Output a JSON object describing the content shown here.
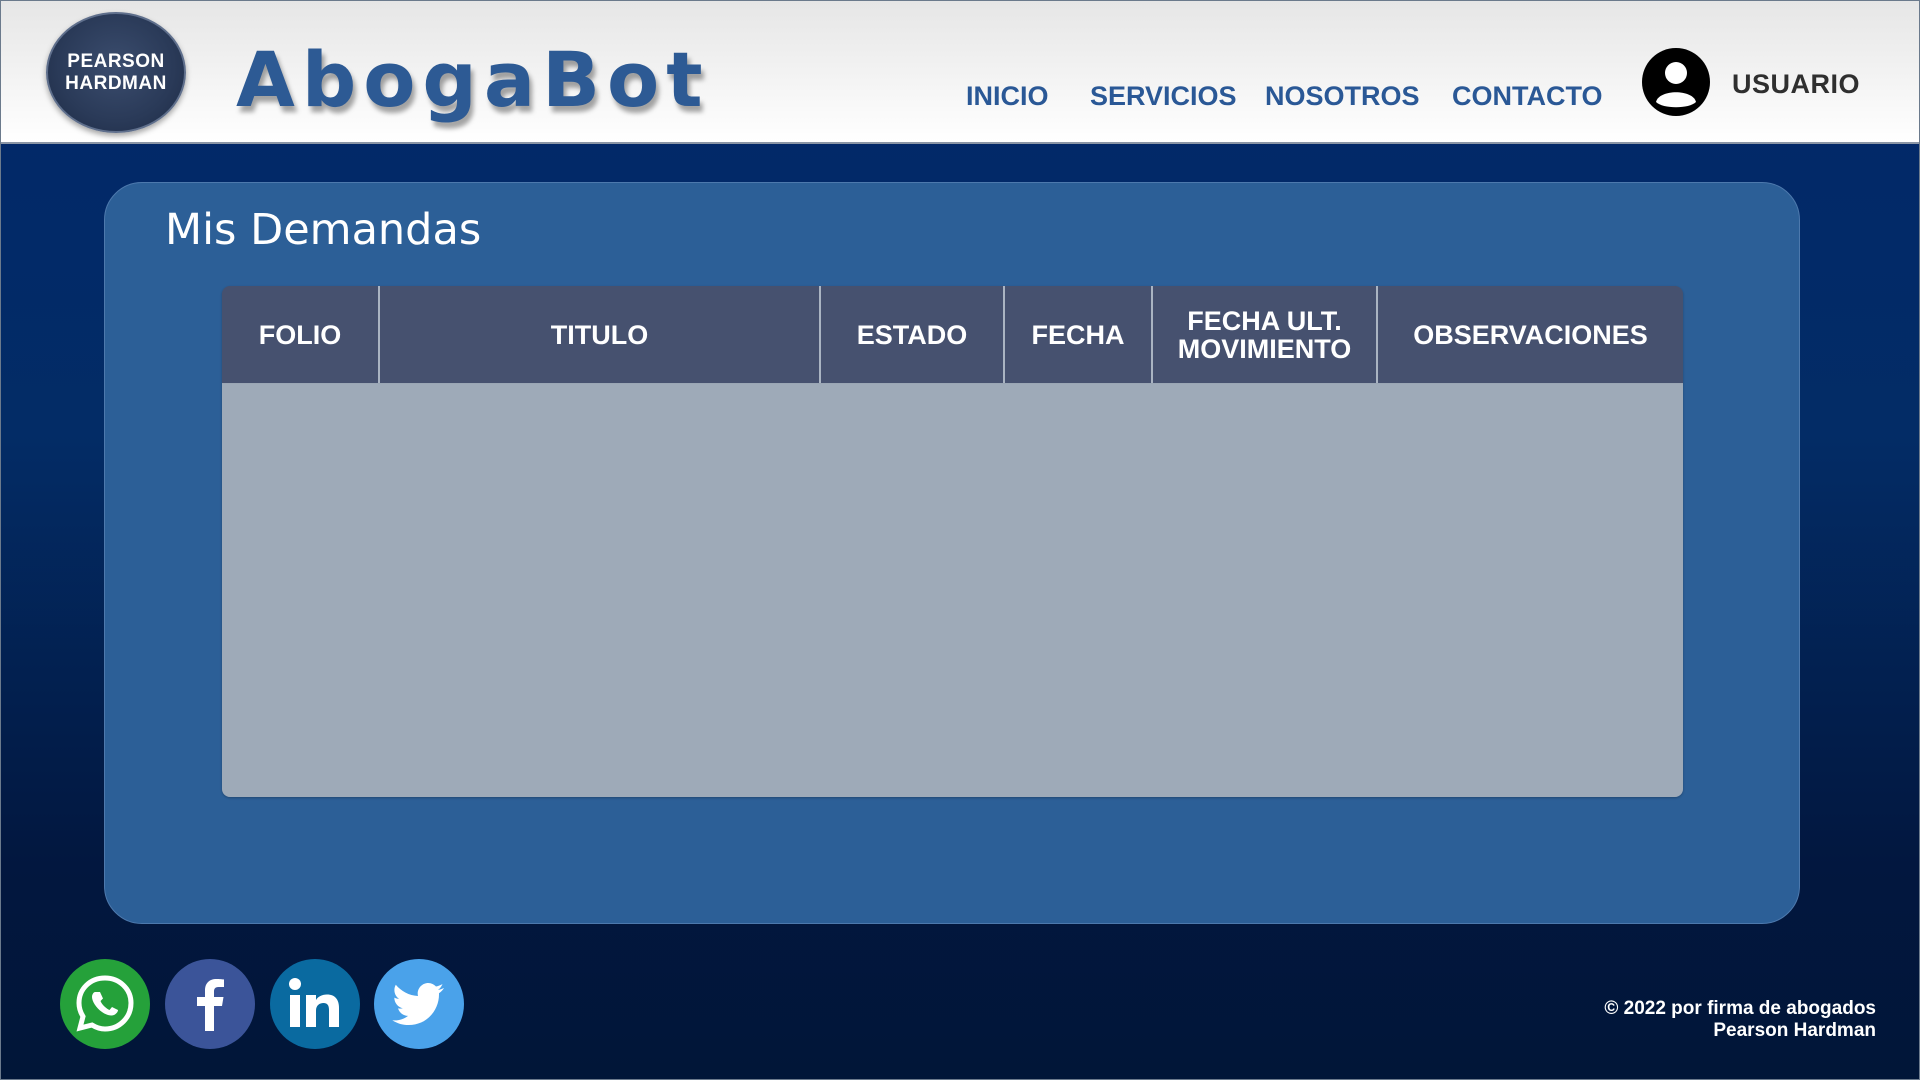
{
  "brand": {
    "badge_line1": "PEARSON",
    "badge_line2": "HARDMAN",
    "name": "AbogaBot"
  },
  "nav": {
    "items": [
      {
        "label": "INICIO"
      },
      {
        "label": "SERVICIOS"
      },
      {
        "label": "NOSOTROS"
      },
      {
        "label": "CONTACTO"
      }
    ],
    "user_label": "USUARIO"
  },
  "main": {
    "title": "Mis Demandas",
    "table": {
      "columns": [
        "FOLIO",
        "TITULO",
        "ESTADO",
        "FECHA",
        "FECHA ULT.\nMOVIMIENTO",
        "OBSERVACIONES"
      ],
      "rows": []
    }
  },
  "footer": {
    "social": [
      {
        "name": "whatsapp",
        "color": "#25a13a"
      },
      {
        "name": "facebook",
        "color": "#3b5499"
      },
      {
        "name": "linkedin",
        "color": "#0a6aa0"
      },
      {
        "name": "twitter",
        "color": "#4aa2ea"
      }
    ],
    "copyright_line1": "© 2022 por firma de abogados",
    "copyright_line2": "Pearson Hardman"
  },
  "colors": {
    "accent": "#2c5f97",
    "nav_text": "#2a5896",
    "table_header": "#46516f",
    "table_body": "#9eaab8"
  }
}
